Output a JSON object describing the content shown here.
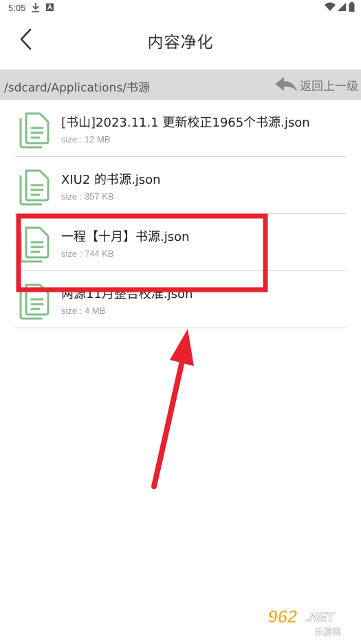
{
  "status_bar": {
    "time": "5:05",
    "icons": [
      "download-icon",
      "a-badge-icon",
      "wifi-icon",
      "signal-icon",
      "battery-icon"
    ]
  },
  "header": {
    "title": "内容净化",
    "back_icon": "chevron-left-icon"
  },
  "path_bar": {
    "path": "/sdcard/Applications/书源",
    "up_label": "返回上一级",
    "up_icon": "back-arrow-icon"
  },
  "files": [
    {
      "name": "[书山]2023.11.1 更新校正1965个书源.json",
      "size": "size : 12 MB"
    },
    {
      "name": "XIU2 的书源.json",
      "size": "size : 357 KB"
    },
    {
      "name": "一程【十月】书源.json",
      "size": "size : 744 KB"
    },
    {
      "name": "两源11月整合校准.json",
      "size": "size : 4 MB"
    }
  ],
  "annotation": {
    "highlight_color": "#e8212e",
    "arrow_color": "#e8212e"
  },
  "watermark": {
    "text": "962.NET",
    "subtext": "乐游网"
  },
  "colors": {
    "icon_green": "#7fbf87",
    "path_bar_bg": "#d9d9d9"
  }
}
